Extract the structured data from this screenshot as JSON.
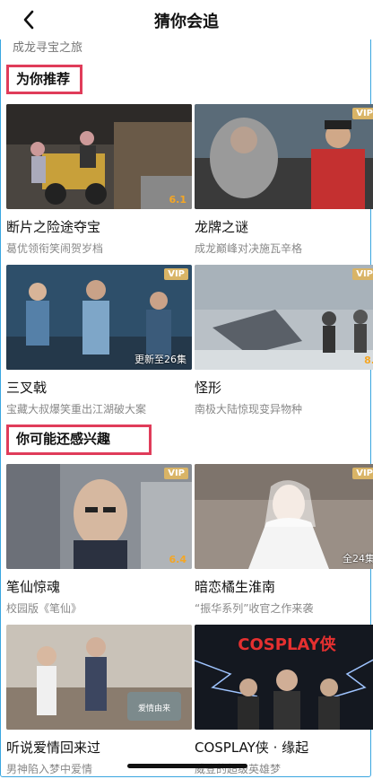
{
  "header": {
    "title": "猜你会追"
  },
  "prev_item": {
    "subtitle": "成龙寻宝之旅"
  },
  "sections": [
    {
      "title": "为你推荐",
      "items": [
        {
          "name": "断片之险途夺宝",
          "desc": "葛优领衔笑闹贺岁档",
          "badge": "",
          "score": "6.1",
          "overlay": ""
        },
        {
          "name": "龙牌之谜",
          "desc": "成龙巅峰对决施瓦辛格",
          "badge": "VIP",
          "score": "",
          "overlay": ""
        },
        {
          "name": "三叉戟",
          "desc": "宝藏大叔爆笑重出江湖破大案",
          "badge": "VIP",
          "score": "",
          "overlay": "更新至26集"
        },
        {
          "name": "怪形",
          "desc": "南极大陆惊现变异物种",
          "badge": "VIP",
          "score": "8.",
          "overlay": ""
        }
      ]
    },
    {
      "title": "你可能还感兴趣",
      "items": [
        {
          "name": "笔仙惊魂",
          "desc": "校园版《笔仙》",
          "badge": "VIP",
          "score": "6.4",
          "overlay": ""
        },
        {
          "name": "暗恋橘生淮南",
          "desc": "“振华系列”收官之作来袭",
          "badge": "VIP",
          "score": "",
          "overlay": "全24集"
        },
        {
          "name": "听说爱情回来过",
          "desc": "男神陷入梦中爱情",
          "badge": "",
          "score": "",
          "overlay": "",
          "sign": "爱情由来"
        },
        {
          "name": "COSPLAY侠 · 缘起",
          "desc": "威登的超级英雄梦",
          "badge": "",
          "score": "",
          "overlay": "",
          "poster_text": "COSPLAY侠"
        }
      ]
    }
  ],
  "colors": {
    "section_outline": "#e03c5a",
    "vip_badge": "#d9b466",
    "score": "#f5a623"
  },
  "icons": {
    "back": "chevron-left-icon"
  }
}
